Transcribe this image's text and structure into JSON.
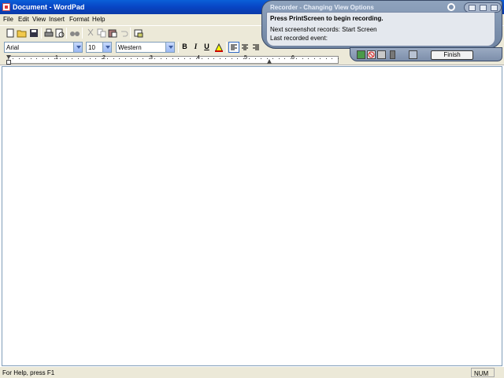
{
  "window": {
    "title": "Document - WordPad"
  },
  "menu": [
    "File",
    "Edit",
    "View",
    "Insert",
    "Format",
    "Help"
  ],
  "toolbar": {
    "icons": [
      "new-icon",
      "open-icon",
      "save-icon",
      "print-icon",
      "print-preview-icon",
      "find-icon",
      "cut-icon",
      "copy-icon",
      "paste-icon",
      "undo-icon",
      "date-time-icon"
    ]
  },
  "format_bar": {
    "font": "Arial",
    "size": "10",
    "script": "Western",
    "bold": "B",
    "italic": "I",
    "underline": "U"
  },
  "ruler": {
    "marks": [
      "1",
      "2",
      "3",
      "4",
      "5",
      "6"
    ]
  },
  "recorder": {
    "title": "Recorder - Changing View Options",
    "line1": "Press PrintScreen to begin recording.",
    "line2": "Next screenshot records: Start Screen",
    "line3": "Last recorded event:",
    "finish_label": "Finish"
  },
  "status": {
    "help": "For Help, press F1",
    "num": "NUM"
  },
  "colors": {
    "titlebar": "#0845c4",
    "chrome": "#ece9d8",
    "recorder": "#7f93b0"
  }
}
